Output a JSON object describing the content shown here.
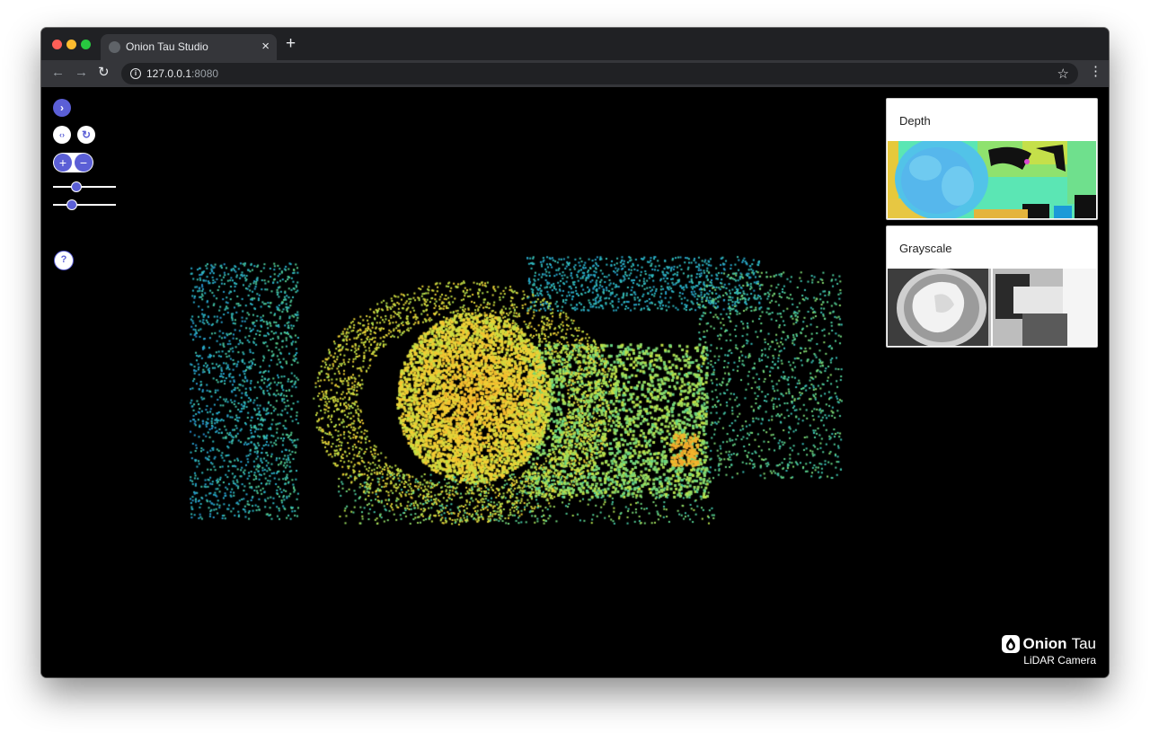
{
  "browser": {
    "tab_title": "Onion Tau Studio",
    "tab_close": "×",
    "new_tab": "+",
    "url_host": "127.0.0.1",
    "url_port": ":8080",
    "back": "←",
    "forward": "→",
    "reload": "↻",
    "star": "☆",
    "menu": "⋮"
  },
  "controls": {
    "toggle_icon": "chevron-right-icon",
    "toggle_glyph": "›",
    "code_glyph": "‹›",
    "rotate_glyph": "↻",
    "zoom_in_glyph": "+",
    "zoom_out_glyph": "−",
    "help_label": "?",
    "slider1_value": 0.35,
    "slider2_value": 0.28
  },
  "panels": {
    "depth_title": "Depth",
    "grayscale_title": "Grayscale"
  },
  "brand": {
    "name": "Onion",
    "product": "Tau",
    "subtitle": "LiDAR Camera"
  },
  "colors": {
    "accent": "#5b5fd6",
    "background": "#000000"
  }
}
